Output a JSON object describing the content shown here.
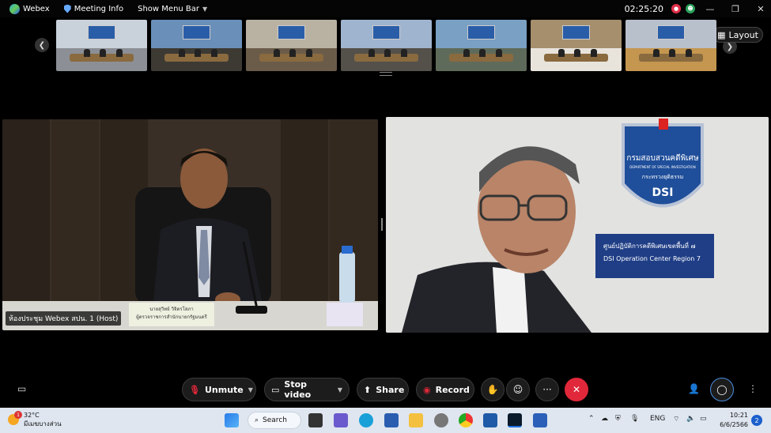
{
  "topbar": {
    "app_name": "Webex",
    "meeting_info": "Meeting Info",
    "show_menu_bar": "Show Menu Bar",
    "time": "02:25:20",
    "avatar_red": "",
    "avatar_green": ""
  },
  "filmstrip": {
    "layout_label": "Layout",
    "thumbnails": [
      {
        "wall": "#c9d1db",
        "floor": "#8c8f95"
      },
      {
        "wall": "#6a8fb8",
        "floor": "#3d3a34"
      },
      {
        "wall": "#b9b1a2",
        "floor": "#6b5c4a"
      },
      {
        "wall": "#9fb4cf",
        "floor": "#54504a"
      },
      {
        "wall": "#7aa0c4",
        "floor": "#5f6b5a"
      },
      {
        "wall": "#a58f6d",
        "floor": "#e8e4dc"
      },
      {
        "wall": "#b8c0cc",
        "floor": "#c4964f"
      }
    ]
  },
  "left_tile": {
    "host_label": "ห้องประชุม Webex สปน. 1 (Host)",
    "nameplate_line1": "นายสุวิทย์ วิจิตรโสภา",
    "nameplate_line2": "ผู้ตรวจราชการสำนักนายกรัฐมนตรี"
  },
  "right_tile": {
    "board_line1": "ศูนย์ปฏิบัติการคดีพิเศษเขตพื้นที่ ๗",
    "board_line2": "DSI Operation Center Region 7",
    "shield_th": "กรมสอบสวนคดีพิเศษ",
    "shield_en": "DEPARTMENT OF SPECIAL INVESTIGATION",
    "shield_ministry": "กระทรวงยุติธรรม",
    "shield_dsi": "DSI"
  },
  "controls": {
    "unmute": "Unmute",
    "stop_video": "Stop video",
    "share": "Share",
    "record": "Record"
  },
  "taskbar": {
    "temperature": "32°C",
    "weather_text": "มีเมฆบางส่วน",
    "weather_badge": "1",
    "search": "Search",
    "lang": "ENG",
    "time": "10:21",
    "date": "6/6/2566",
    "notifications": "2"
  },
  "colors": {
    "end_call": "#e0283a",
    "record_dot": "#e0283a",
    "unmute_icon": "#e0283a"
  }
}
